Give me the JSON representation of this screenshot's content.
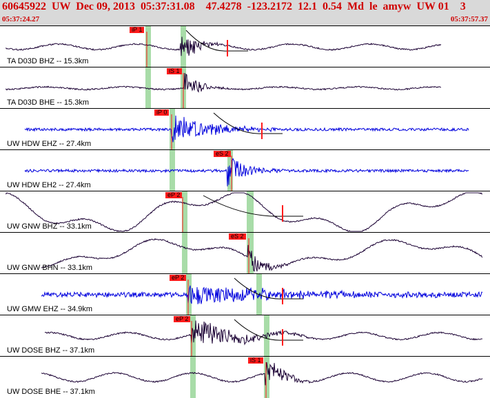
{
  "header": {
    "title": "60645922  UW  Dec 09, 2013  05:37:31.08    47.4278  -123.2172  12.1  0.54  Md  le  amyw  UW 01    3",
    "time_start": "05:37:24.27",
    "time_end": "05:37:57.37"
  },
  "colors": {
    "header_bg": "#d9d9d9",
    "title_text": "#d00000",
    "pick_marker": "#ff1a1a",
    "window_band": "#a8dca8",
    "trace_short_period": "#0000dd",
    "trace_broadband": "#1a0033"
  },
  "traces": [
    {
      "label": "TA D03D BHZ -- 15.3km",
      "pick": "iP 1",
      "color": "dark"
    },
    {
      "label": "TA D03D BHE -- 15.3km",
      "pick": "iS 1",
      "color": "dark"
    },
    {
      "label": "UW HDW EHZ -- 27.4km",
      "pick": "iP 0",
      "color": "blue"
    },
    {
      "label": "UW HDW EH2 -- 27.4km",
      "pick": "eS 2",
      "color": "blue"
    },
    {
      "label": "UW GNW BHZ -- 33.1km",
      "pick": "eP 2",
      "color": "dark"
    },
    {
      "label": "UW GNW BHN -- 33.1km",
      "pick": "eS 2",
      "color": "dark"
    },
    {
      "label": "UW GMW EHZ -- 34.9km",
      "pick": "eP 2",
      "color": "blue"
    },
    {
      "label": "UW DOSE BHZ -- 37.1km",
      "pick": "eP 2",
      "color": "dark"
    },
    {
      "label": "UW DOSE BHE -- 37.1km",
      "pick": "iS 1",
      "color": "dark"
    }
  ]
}
